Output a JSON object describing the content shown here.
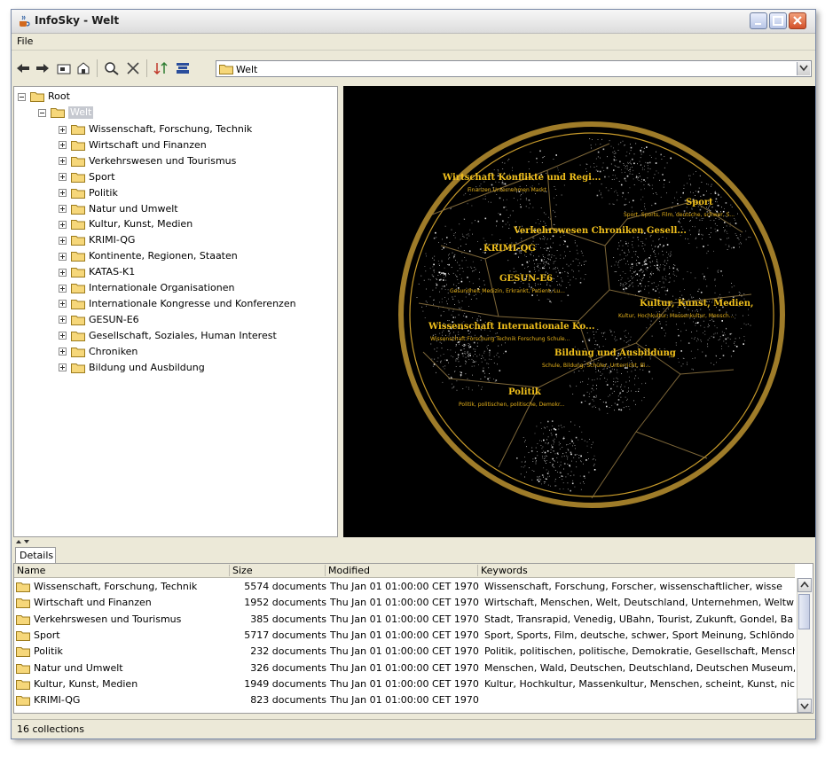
{
  "window": {
    "title": "InfoSky - Welt"
  },
  "menu": {
    "file": "File"
  },
  "toolbar": {
    "icons": [
      "back-arrow-icon",
      "forward-arrow-icon",
      "folder-up-icon",
      "home-icon",
      "search-zoom-icon",
      "close-x-icon",
      "sort-icon",
      "filter-icon"
    ],
    "path_value": "Welt"
  },
  "tree": {
    "root": "Root",
    "selected": "Welt",
    "children": [
      "Wissenschaft, Forschung, Technik",
      "Wirtschaft und Finanzen",
      "Verkehrswesen und Tourismus",
      "Sport",
      "Politik",
      "Natur und Umwelt",
      "Kultur, Kunst, Medien",
      "KRIMI-QG",
      "Kontinente, Regionen, Staaten",
      "KATAS-K1",
      "Internationale Organisationen",
      "Internationale Kongresse und Konferenzen",
      "GESUN-E6",
      "Gesellschaft, Soziales, Human Interest",
      "Chroniken",
      "Bildung und Ausbildung"
    ]
  },
  "viz": {
    "labels": [
      {
        "title": "Wirtschaft Konflikte und Regi...",
        "sub": "Finanzen Unternehmen Markt"
      },
      {
        "title": "Sport",
        "sub": "Sport, Sports, Film, deutsche, schwer, S..."
      },
      {
        "title": "Verkehrswesen Chroniken Gesell...",
        "sub": ""
      },
      {
        "title": "KRIMI-QG",
        "sub": ""
      },
      {
        "title": "GESUN-E6",
        "sub": "Gesundheit Medizin, Erkrankt, Patient, Lu..."
      },
      {
        "title": "Kultur, Kunst, Medien,",
        "sub": "Kultur, Hochkultur, Massenkultur, Mensch..."
      },
      {
        "title": "Wissenschaft Internationale Ko...",
        "sub": "Wissenschaft Forschung Technik Forschung Schule..."
      },
      {
        "title": "Bildung und Ausbildung",
        "sub": "Schule, Bildung, Schüler, Unterricht, Bi..."
      },
      {
        "title": "Politik",
        "sub": "Politik, politischen, politische, Demokr..."
      }
    ]
  },
  "details": {
    "tab": "Details",
    "columns": [
      "Name",
      "Size",
      "Modified",
      "Keywords"
    ],
    "rows": [
      {
        "name": "Wissenschaft, Forschung, Technik",
        "size": "5574 documents",
        "modified": "Thu Jan 01 01:00:00 CET 1970",
        "keywords": "Wissenschaft, Forschung, Forscher, wissenschaftlicher, wisse"
      },
      {
        "name": "Wirtschaft und Finanzen",
        "size": "1952 documents",
        "modified": "Thu Jan 01 01:00:00 CET 1970",
        "keywords": "Wirtschaft, Menschen, Welt, Deutschland, Unternehmen, Weltwi"
      },
      {
        "name": "Verkehrswesen und Tourismus",
        "size": "385 documents",
        "modified": "Thu Jan 01 01:00:00 CET 1970",
        "keywords": "Stadt, Transrapid, Venedig, UBahn, Tourist, Zukunft, Gondel, Ba"
      },
      {
        "name": "Sport",
        "size": "5717 documents",
        "modified": "Thu Jan 01 01:00:00 CET 1970",
        "keywords": "Sport, Sports, Film, deutsche, schwer, Sport Meinung, Schlöndo"
      },
      {
        "name": "Politik",
        "size": "232 documents",
        "modified": "Thu Jan 01 01:00:00 CET 1970",
        "keywords": "Politik, politischen, politische, Demokratie, Gesellschaft, Mensche"
      },
      {
        "name": "Natur und Umwelt",
        "size": "326 documents",
        "modified": "Thu Jan 01 01:00:00 CET 1970",
        "keywords": "Menschen, Wald, Deutschen, Deutschland, Deutschen Museum,"
      },
      {
        "name": "Kultur, Kunst, Medien",
        "size": "1949 documents",
        "modified": "Thu Jan 01 01:00:00 CET 1970",
        "keywords": "Kultur, Hochkultur, Massenkultur, Menschen, scheint, Kunst, nicl"
      },
      {
        "name": "KRIMI-QG",
        "size": "823 documents",
        "modified": "Thu Jan 01 01:00:00 CET 1970",
        "keywords": ""
      }
    ]
  },
  "status": {
    "text": "16 collections"
  },
  "colors": {
    "viz_label": "#f1c01c",
    "viz_boundary": "#b08a2e",
    "selection": "#c6c9d0"
  }
}
